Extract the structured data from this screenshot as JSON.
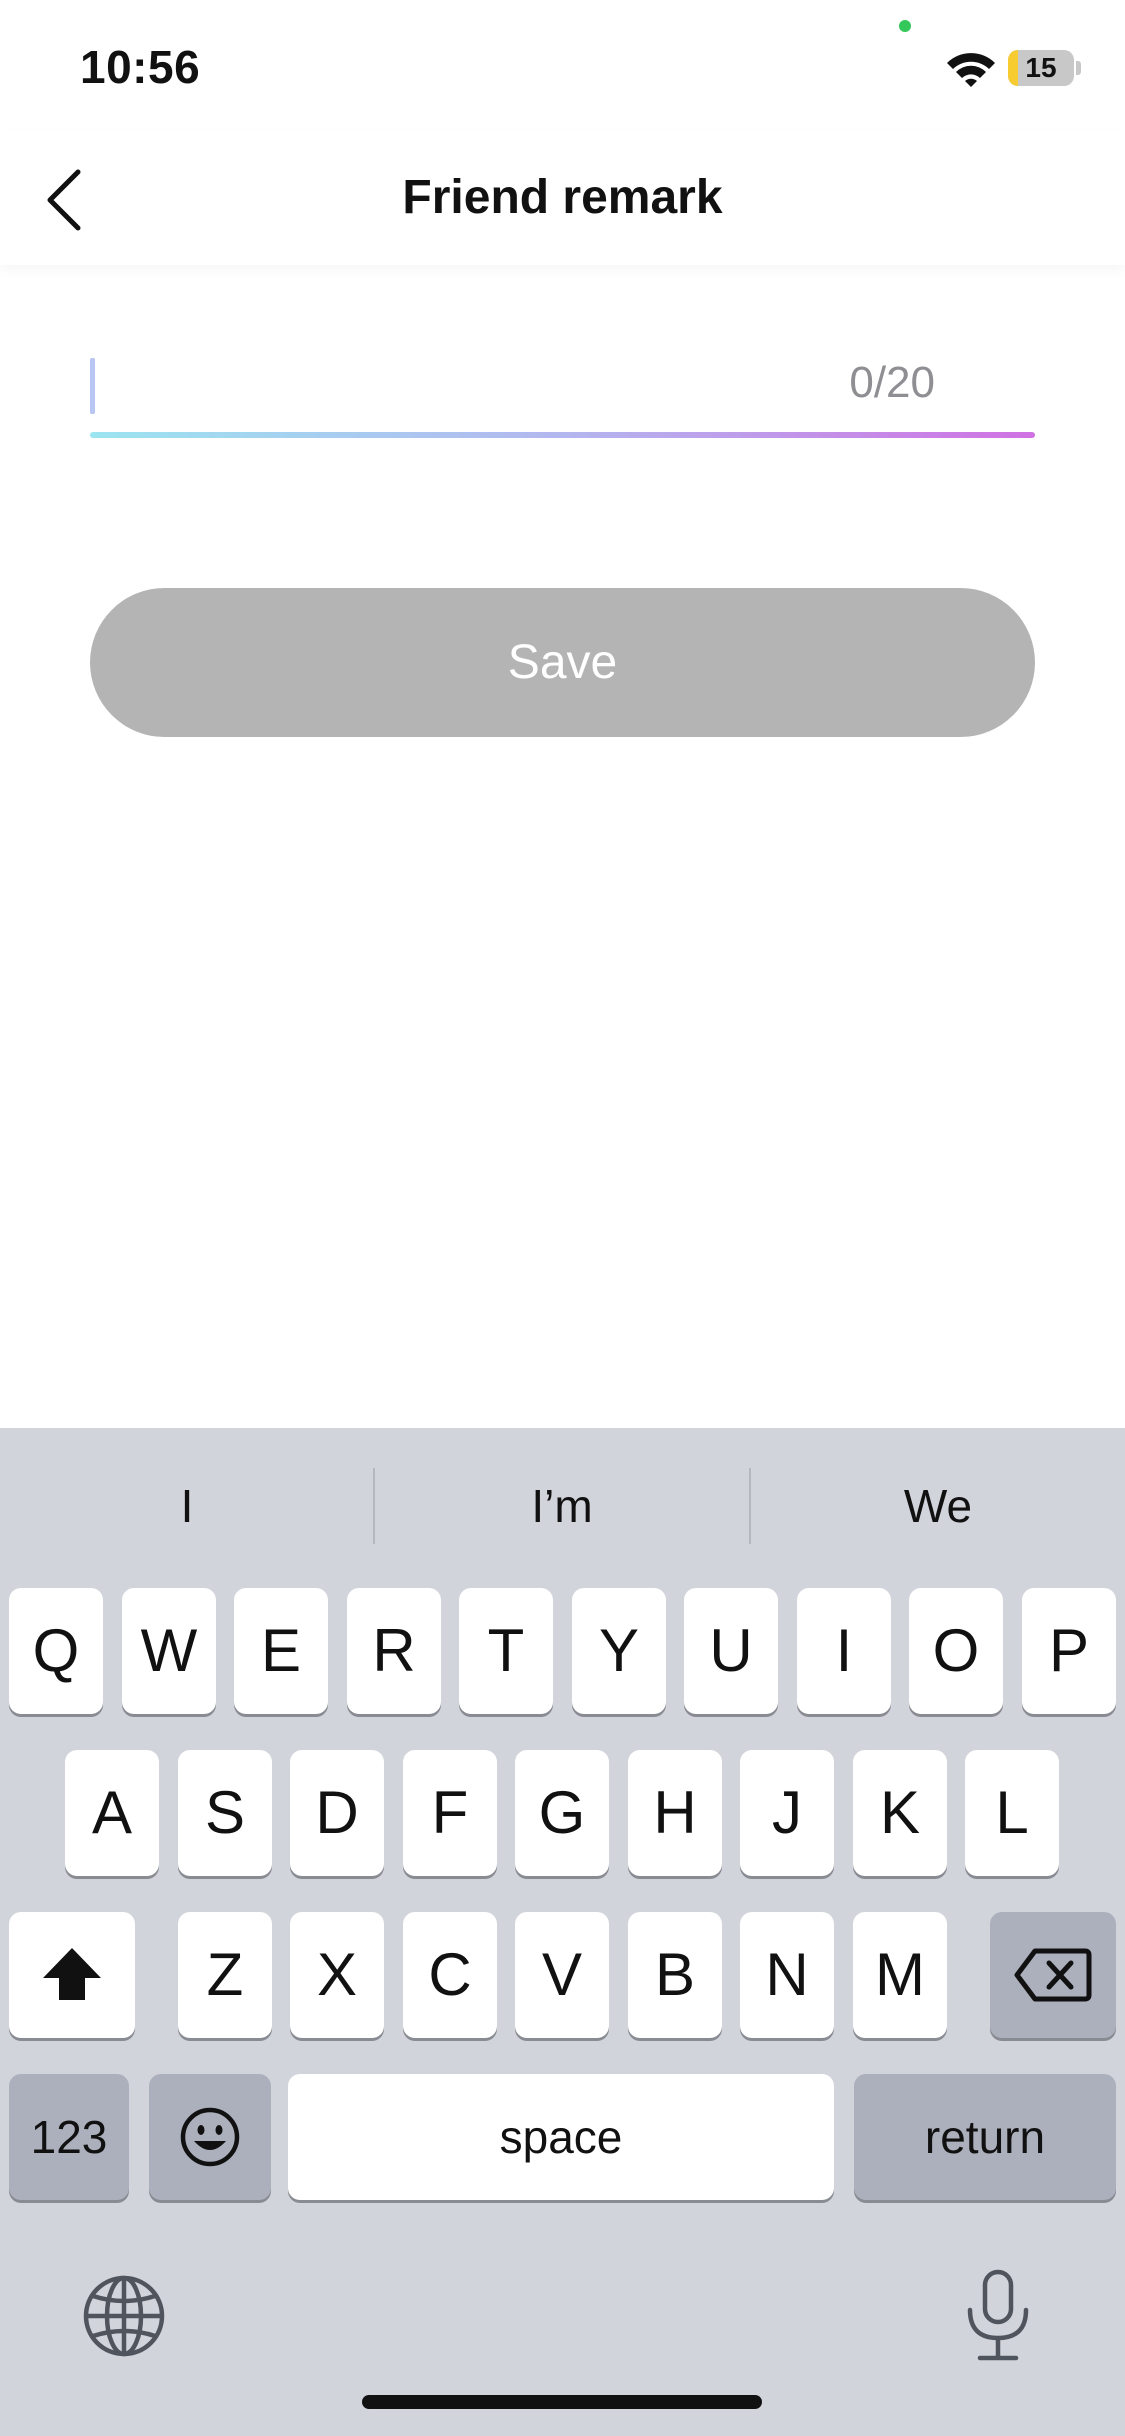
{
  "status_bar": {
    "time": "10:56",
    "battery_level": "15",
    "battery_fraction": 0.15,
    "battery_color": "#f7cc31",
    "icons": [
      "wifi-icon",
      "battery-icon",
      "camera-indicator-dot"
    ]
  },
  "nav": {
    "title": "Friend remark",
    "back_icon": "chevron-left-icon"
  },
  "form": {
    "input_value": "",
    "counter": "0/20",
    "save_label": "Save",
    "save_color": "#b4b4b4"
  },
  "keyboard": {
    "suggestions": [
      "I",
      "I’m",
      "We"
    ],
    "row1": [
      "Q",
      "W",
      "E",
      "R",
      "T",
      "Y",
      "U",
      "I",
      "O",
      "P"
    ],
    "row2": [
      "A",
      "S",
      "D",
      "F",
      "G",
      "H",
      "J",
      "K",
      "L"
    ],
    "row3": [
      "Z",
      "X",
      "C",
      "V",
      "B",
      "N",
      "M"
    ],
    "numbers_label": "123",
    "space_label": "space",
    "return_label": "return",
    "icons": [
      "shift-icon",
      "backspace-icon",
      "emoji-icon",
      "globe-icon",
      "microphone-icon"
    ]
  }
}
